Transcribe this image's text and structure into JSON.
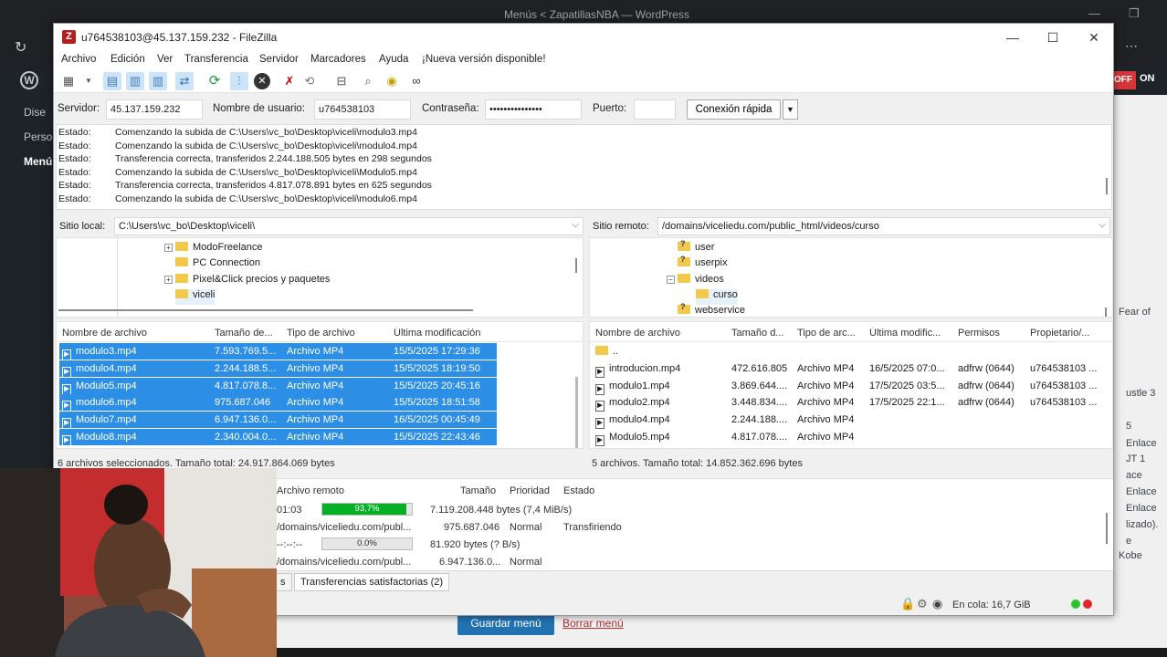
{
  "browser": {
    "title": "Menús < ZapatillasNBA — WordPress"
  },
  "wordpress": {
    "sidebar_items": [
      "Dise",
      "Perso",
      "Menú"
    ],
    "toggle_off": "OFF",
    "toggle_on": "ON",
    "right_snippets": [
      "Fear of",
      "ustle 3",
      "5",
      "Enlace",
      "JT 1",
      "ace",
      "Enlace",
      "Enlace",
      "lizado).",
      "e",
      "Kobe"
    ],
    "save_button": "Guardar menú",
    "delete_link": "Borrar menú"
  },
  "filezilla": {
    "window_title": "u764538103@45.137.159.232 - FileZilla",
    "menu": [
      "Archivo",
      "Edición",
      "Ver",
      "Transferencia",
      "Servidor",
      "Marcadores",
      "Ayuda",
      "¡Nueva versión disponible!"
    ],
    "quickconnect": {
      "host_label": "Servidor:",
      "host_value": "45.137.159.232",
      "user_label": "Nombre de usuario:",
      "user_value": "u764538103",
      "pass_label": "Contraseña:",
      "pass_value": "•••••••••••••••",
      "port_label": "Puerto:",
      "port_value": "",
      "button": "Conexión rápida"
    },
    "log": [
      {
        "status": "Estado:",
        "msg": "Comenzando la subida de C:\\Users\\vc_bo\\Desktop\\viceli\\modulo3.mp4"
      },
      {
        "status": "Estado:",
        "msg": "Comenzando la subida de C:\\Users\\vc_bo\\Desktop\\viceli\\modulo4.mp4"
      },
      {
        "status": "Estado:",
        "msg": "Transferencia correcta, transferidos 2.244.188.505 bytes en 298 segundos"
      },
      {
        "status": "Estado:",
        "msg": "Comenzando la subida de C:\\Users\\vc_bo\\Desktop\\viceli\\Modulo5.mp4"
      },
      {
        "status": "Estado:",
        "msg": "Transferencia correcta, transferidos 4.817.078.891 bytes en 625 segundos"
      },
      {
        "status": "Estado:",
        "msg": "Comenzando la subida de C:\\Users\\vc_bo\\Desktop\\viceli\\modulo6.mp4"
      }
    ],
    "local": {
      "site_label": "Sitio local:",
      "site_path": "C:\\Users\\vc_bo\\Desktop\\viceli\\",
      "tree": [
        "ModoFreelance",
        "PC Connection",
        "Pixel&Click precios y paquetes",
        "viceli"
      ],
      "columns": [
        "Nombre de archivo",
        "Tamaño de...",
        "Tipo de archivo",
        "Última modificación"
      ],
      "files": [
        {
          "name": "modulo3.mp4",
          "size": "7.593.769.5...",
          "type": "Archivo MP4",
          "modified": "15/5/2025 17:29:36"
        },
        {
          "name": "modulo4.mp4",
          "size": "2.244.188.5...",
          "type": "Archivo MP4",
          "modified": "15/5/2025 18:19:50"
        },
        {
          "name": "Modulo5.mp4",
          "size": "4.817.078.8...",
          "type": "Archivo MP4",
          "modified": "15/5/2025 20:45:16"
        },
        {
          "name": "modulo6.mp4",
          "size": "975.687.046",
          "type": "Archivo MP4",
          "modified": "15/5/2025 18:51:58"
        },
        {
          "name": "Modulo7.mp4",
          "size": "6.947.136.0...",
          "type": "Archivo MP4",
          "modified": "16/5/2025 00:45:49"
        },
        {
          "name": "Modulo8.mp4",
          "size": "2.340.004.0...",
          "type": "Archivo MP4",
          "modified": "15/5/2025 22:43:46"
        }
      ],
      "status": "6 archivos seleccionados. Tamaño total: 24.917.864.069 bytes"
    },
    "remote": {
      "site_label": "Sitio remoto:",
      "site_path": "/domains/viceliedu.com/public_html/videos/curso",
      "tree": [
        "user",
        "userpix",
        "videos",
        "curso",
        "webservice"
      ],
      "columns": [
        "Nombre de archivo",
        "Tamaño d...",
        "Tipo de arc...",
        "Última modific...",
        "Permisos",
        "Propietario/..."
      ],
      "files": [
        {
          "name": "..",
          "size": "",
          "type": "",
          "modified": "",
          "perms": "",
          "owner": ""
        },
        {
          "name": "introducion.mp4",
          "size": "472.616.805",
          "type": "Archivo MP4",
          "modified": "16/5/2025 07:0...",
          "perms": "adfrw (0644)",
          "owner": "u764538103 ..."
        },
        {
          "name": "modulo1.mp4",
          "size": "3.869.644....",
          "type": "Archivo MP4",
          "modified": "17/5/2025 03:5...",
          "perms": "adfrw (0644)",
          "owner": "u764538103 ..."
        },
        {
          "name": "modulo2.mp4",
          "size": "3.448.834....",
          "type": "Archivo MP4",
          "modified": "17/5/2025 22:1...",
          "perms": "adfrw (0644)",
          "owner": "u764538103 ..."
        },
        {
          "name": "modulo4.mp4",
          "size": "2.244.188....",
          "type": "Archivo MP4",
          "modified": "",
          "perms": "",
          "owner": ""
        },
        {
          "name": "Modulo5.mp4",
          "size": "4.817.078....",
          "type": "Archivo MP4",
          "modified": "",
          "perms": "",
          "owner": ""
        }
      ],
      "status": "5 archivos. Tamaño total: 14.852.362.696 bytes"
    },
    "queue": {
      "columns": [
        "Archivo remoto",
        "Tamaño",
        "Prioridad",
        "Estado"
      ],
      "rows": [
        {
          "time": "01:03",
          "progress_text": "93,7%",
          "progress": 0.937,
          "detail": "7.119.208.448 bytes (7,4 MiB/s)",
          "remote": "",
          "size": "",
          "priority": "",
          "state": ""
        },
        {
          "time": "",
          "progress_text": "",
          "progress": null,
          "detail": "",
          "remote": "/domains/viceliedu.com/publ...",
          "size": "975.687.046",
          "priority": "Normal",
          "state": "Transfiriendo"
        },
        {
          "time": "--:--:--",
          "progress_text": "0.0%",
          "progress": 0.0,
          "detail": "81.920 bytes (? B/s)",
          "remote": "",
          "size": "",
          "priority": "",
          "state": ""
        },
        {
          "time": "",
          "progress_text": "",
          "progress": null,
          "detail": "",
          "remote": "/domains/viceliedu.com/publ...",
          "size": "6.947.136.0...",
          "priority": "Normal",
          "state": ""
        }
      ],
      "tabs": [
        "s",
        "Transferencias satisfactorias (2)"
      ]
    },
    "statusbar": {
      "queue": "En cola: 16,7 GiB"
    }
  },
  "colors": {
    "selection": "#2d8ee6",
    "progress_green": "#06b025",
    "wp_blue": "#2271b1"
  }
}
